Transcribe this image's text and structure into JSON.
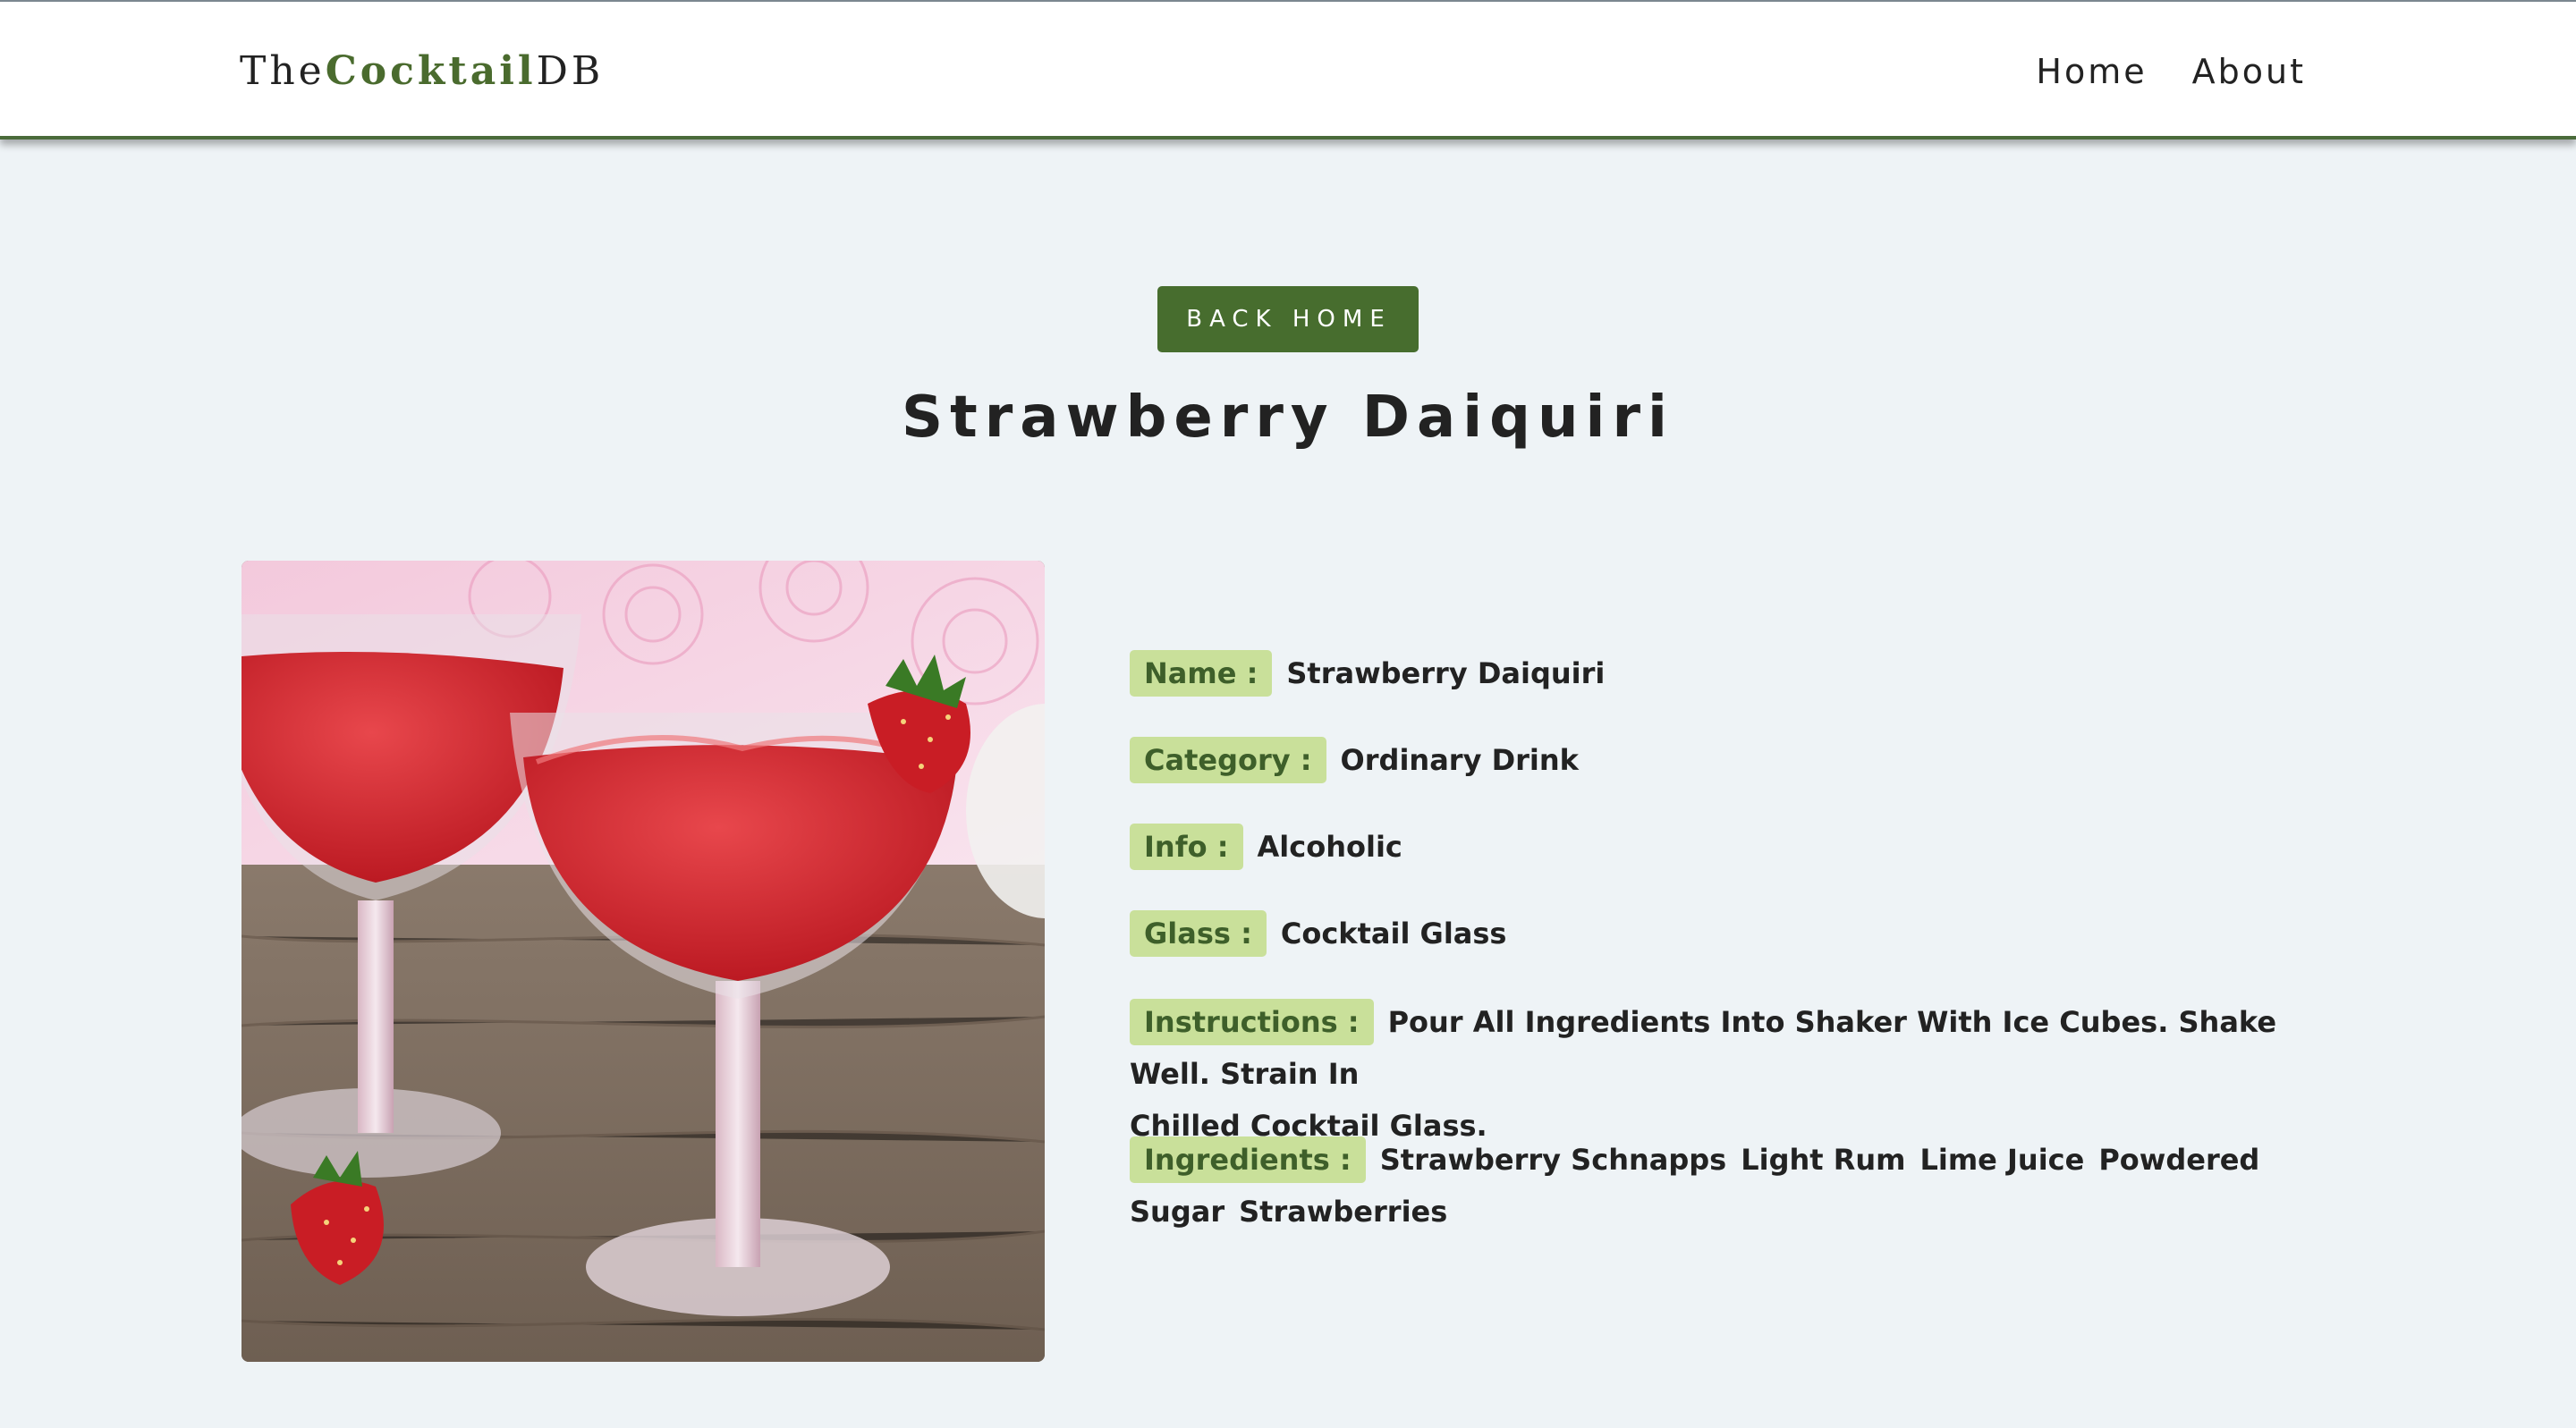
{
  "navbar": {
    "logo_prefix": "The",
    "logo_accent": "Cocktail",
    "logo_suffix": "DB",
    "links": [
      {
        "label": "Home"
      },
      {
        "label": "About"
      }
    ]
  },
  "page": {
    "back_button_label": "Back Home",
    "title": "Strawberry Daiquiri"
  },
  "drink": {
    "image_alt": "Strawberry Daiquiri",
    "fields": {
      "name": {
        "label": "Name :",
        "value": "Strawberry Daiquiri"
      },
      "category": {
        "label": "Category :",
        "value": "Ordinary Drink"
      },
      "info": {
        "label": "Info :",
        "value": "Alcoholic"
      },
      "glass": {
        "label": "Glass :",
        "value": "Cocktail Glass"
      },
      "instructions": {
        "label": "Instructions :",
        "value_line1": "Pour All Ingredients Into Shaker With Ice Cubes. Shake Well. Strain In",
        "value_line2": "Chilled Cocktail Glass."
      },
      "ingredients": {
        "label": "Ingredients :",
        "items": [
          "Strawberry Schnapps",
          "Light Rum",
          "Lime Juice",
          "Powdered Sugar",
          "Strawberries"
        ],
        "line1_items": [
          "Strawberry Schnapps",
          "Light Rum",
          "Lime Juice",
          "Powdered"
        ],
        "line2_items": [
          "Sugar",
          "Strawberries"
        ]
      }
    }
  },
  "colors": {
    "accent_green": "#476d2e",
    "label_bg": "#c9e09a",
    "label_text": "#3e5f2a",
    "page_bg": "#eef3f6"
  }
}
